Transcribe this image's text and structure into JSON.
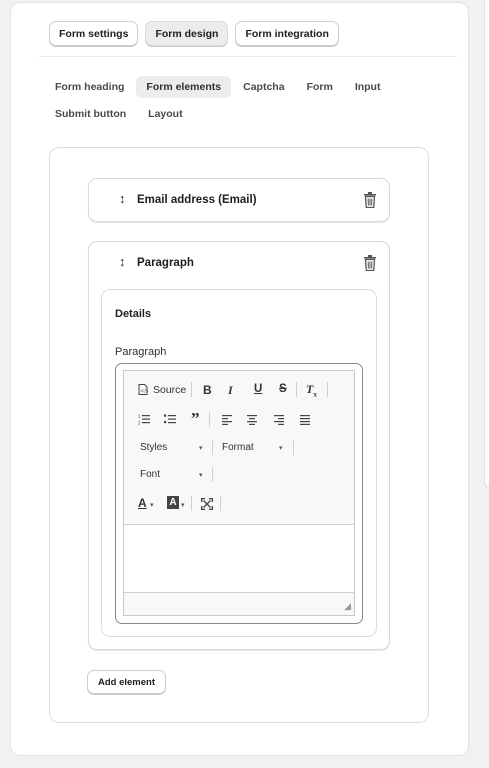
{
  "top_tabs": [
    "Form settings",
    "Form design",
    "Form integration"
  ],
  "sub_tabs": [
    "Form heading",
    "Form elements",
    "Captcha",
    "Form",
    "Input",
    "Submit button",
    "Layout"
  ],
  "elements": [
    {
      "title": "Email address (Email)"
    },
    {
      "title": "Paragraph"
    }
  ],
  "details": {
    "heading": "Details",
    "field_label": "Paragraph"
  },
  "editor": {
    "source_label": "Source",
    "bold": "B",
    "italic": "I",
    "underline": "U",
    "strike": "S",
    "styles_label": "Styles",
    "format_label": "Format",
    "font_label": "Font"
  },
  "add_element_label": "Add element",
  "icons": [
    "drag-handle-icon",
    "trash-icon",
    "source-icon",
    "numbered-list-icon",
    "bulleted-list-icon",
    "blockquote-icon",
    "align-left-icon",
    "align-center-icon",
    "align-right-icon",
    "justify-icon",
    "text-color-icon",
    "background-color-icon",
    "maximize-icon",
    "remove-format-icon",
    "resize-grip-icon"
  ]
}
